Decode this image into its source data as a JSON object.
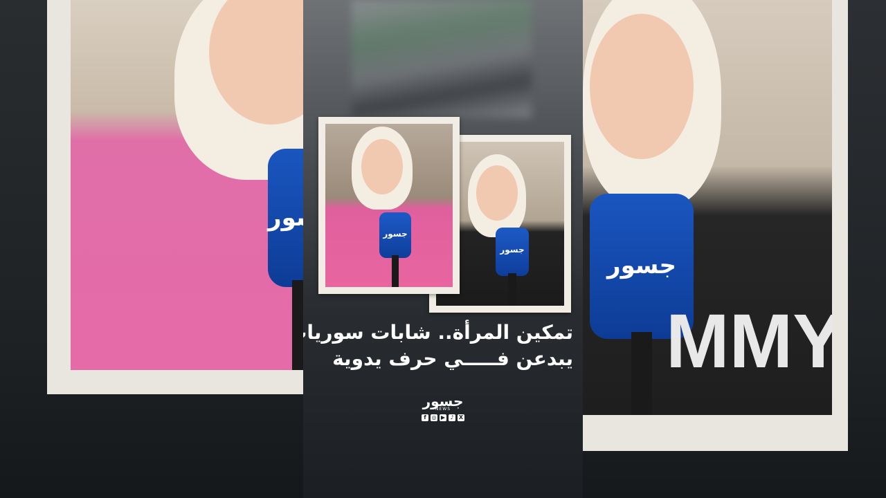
{
  "headline": {
    "line1": "تمكين المرأة.. شابات سوريات",
    "line2": "يبدعن فـــــي حرف يدوية"
  },
  "brand": {
    "logo_word": "جسور",
    "logo_sub": "NEWS",
    "mic_label": "جسور",
    "socials": [
      {
        "icon": "facebook-icon",
        "glyph": "f"
      },
      {
        "icon": "instagram-icon",
        "glyph": "◎"
      },
      {
        "icon": "youtube-icon",
        "glyph": "▶"
      },
      {
        "icon": "tiktok-icon",
        "glyph": "♪"
      },
      {
        "icon": "x-icon",
        "glyph": "X"
      }
    ]
  },
  "shirt_text": "MMY",
  "colors": {
    "frame": "#f1ede4",
    "mic_blue": "#1a56c0",
    "pink_shirt": "#e5649f",
    "text": "#ffffff"
  }
}
